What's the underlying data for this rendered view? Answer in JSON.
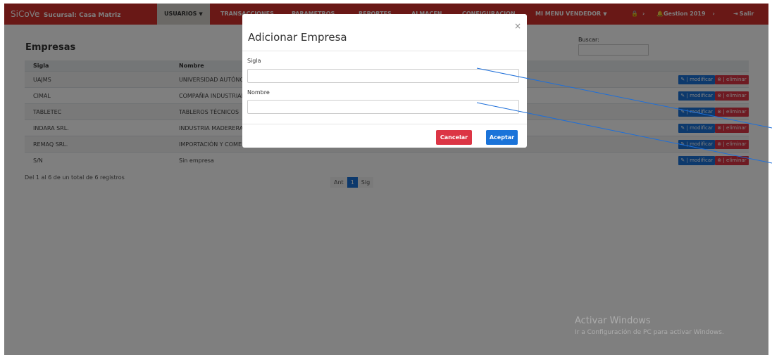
{
  "navbar": {
    "brand": "SiCoVe",
    "branch": "Sucursal: Casa Matriz",
    "menu": [
      {
        "label": "USUARIOS"
      },
      {
        "label": "TRANSACCIONES"
      },
      {
        "label": "PARAMETROS"
      },
      {
        "label": "REPORTES"
      },
      {
        "label": "ALMACEN"
      },
      {
        "label": "CONFIGURACION"
      },
      {
        "label": "MI MENU VENDEDOR"
      }
    ],
    "gestion": "Gestion 2019",
    "salir": "Salir"
  },
  "page": {
    "title": "Empresas",
    "search_label": "Buscar:"
  },
  "table": {
    "headers": [
      "Sigla",
      "Nombre"
    ],
    "rows": [
      {
        "sigla": "UAJMS",
        "nombre": "UNIVERSIDAD AUTÓNOMA JUAN MISAEL SARACHO"
      },
      {
        "sigla": "CIMAL",
        "nombre": "COMPAÑIA INDUSTRIAL MADERERA"
      },
      {
        "sigla": "TABLETEC",
        "nombre": "TABLEROS TÉCNICOS"
      },
      {
        "sigla": "INDARA SRL.",
        "nombre": "INDUSTRIA MADERERA ARANDA"
      },
      {
        "sigla": "REMAQ SRL.",
        "nombre": "IMPORTACIÓN Y COMERCIALIZACIÓN DE MAQUINARIA"
      },
      {
        "sigla": "S/N",
        "nombre": "Sin empresa"
      }
    ],
    "modify_label": "✎ | modificar",
    "delete_label": "⊗ | eliminar"
  },
  "footer": {
    "records": "Del 1 al 6 de un total de 6 registros",
    "pager": {
      "prev": "Ant",
      "current": "1",
      "next": "Sig"
    }
  },
  "modal": {
    "title": "Adicionar Empresa",
    "close": "×",
    "sigla_label": "Sigla",
    "sigla_value": "",
    "nombre_label": "Nombre",
    "nombre_value": "",
    "cancel": "Cancelar",
    "accept": "Aceptar"
  },
  "watermark": {
    "line1": "Activar Windows",
    "line2": "Ir a Configuración de PC para activar Windows."
  },
  "colors": {
    "navbar": "#d2302d",
    "primary": "#1a73d9",
    "danger": "#dc3545",
    "annotation_line": "#1e6fd9"
  }
}
